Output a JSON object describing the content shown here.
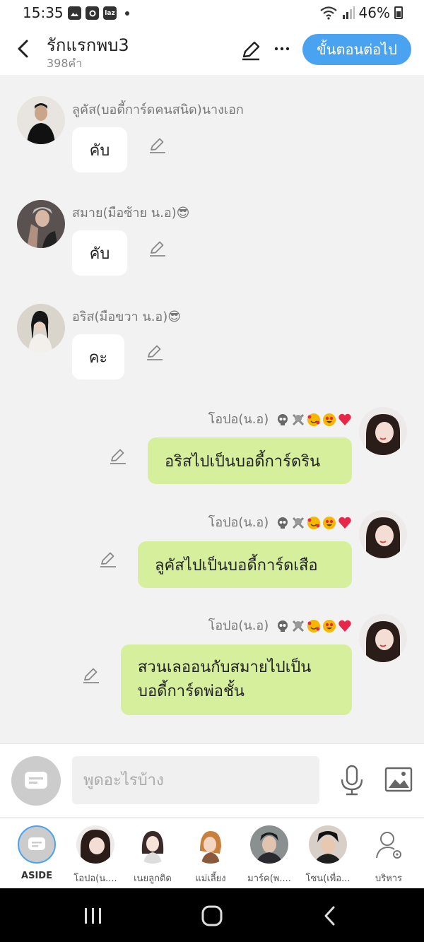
{
  "status_bar": {
    "time": "15:35",
    "battery": "46%",
    "laz": "laz"
  },
  "header": {
    "title": "รักแรกพบ3",
    "subtitle": "398คำ",
    "next_label": "ขั้นตอนต่อไป"
  },
  "messages": [
    {
      "side": "left",
      "name": "ลูคัส(บอดี้การ์ดคนสนิด)นางเอก",
      "text": "คับ"
    },
    {
      "side": "left",
      "name": "สมาย(มือซ้าย น.อ)😎",
      "text": "คับ"
    },
    {
      "side": "left",
      "name": "อริส(มือขวา น.อ)😎",
      "text": "คะ"
    },
    {
      "side": "right",
      "name": "โอปอ(น.อ)",
      "text": "อริสไปเป็นบอดี้การ์ดริน"
    },
    {
      "side": "right",
      "name": "โอปอ(น.อ)",
      "text": "ลูคัสไปเป็นบอดี้การ์ดเสือ"
    },
    {
      "side": "right",
      "name": "โอปอ(น.อ)",
      "text_line1": "สวนเลออนกับสมายไปเป็น",
      "text_line2": "บอดี้การ์ดพ่อชั้น"
    }
  ],
  "input": {
    "placeholder": "พูดอะไรบ้าง"
  },
  "characters": [
    {
      "label": "ASIDE"
    },
    {
      "label": "โอปอ(น...."
    },
    {
      "label": "เนยลูกติด"
    },
    {
      "label": "แม่เลี้ยง"
    },
    {
      "label": "มาร์ค(พ...."
    },
    {
      "label": "โซน(เพื่อ..."
    },
    {
      "label": "บริหาร"
    }
  ],
  "colors": {
    "accent": "#4aa3f0",
    "own_bubble": "#d6ef9c",
    "other_bubble": "#ffffff",
    "background": "#f2f2f2"
  }
}
